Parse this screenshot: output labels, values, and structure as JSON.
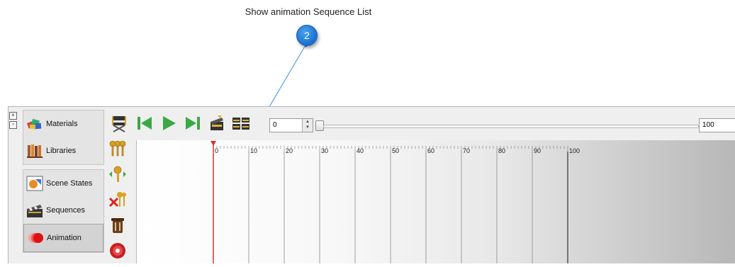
{
  "annotation": {
    "callout_text": "Show animation Sequence List",
    "badge_number": "2",
    "badge_color": "#1a6fd0"
  },
  "window_controls": [
    "close-icon",
    "float-icon"
  ],
  "sidebar": {
    "items": [
      {
        "label": "Materials",
        "icon": "materials-icon",
        "active": false
      },
      {
        "label": "Libraries",
        "icon": "libraries-icon",
        "active": false
      },
      {
        "label": "Scene States",
        "icon": "scene-states-icon",
        "active": false
      },
      {
        "label": "Sequences",
        "icon": "sequences-icon",
        "active": false
      },
      {
        "label": "Animation",
        "icon": "animation-icon",
        "active": true
      }
    ]
  },
  "toolbar": {
    "buttons": [
      "director-chair-icon",
      "skip-to-start-icon",
      "play-icon",
      "skip-to-end-icon",
      "clapperboard-icon",
      "sequence-list-icon"
    ],
    "current_frame": "0",
    "end_frame": "100"
  },
  "left_tools": [
    "add-keys-icon",
    "move-key-icon",
    "delete-keys-icon",
    "trash-icon",
    "record-icon"
  ],
  "timeline": {
    "ticks": [
      "0",
      "10",
      "20",
      "30",
      "40",
      "50",
      "60",
      "70",
      "80",
      "90",
      "100"
    ],
    "playhead_frame": 0,
    "playhead_color": "#e03030"
  }
}
